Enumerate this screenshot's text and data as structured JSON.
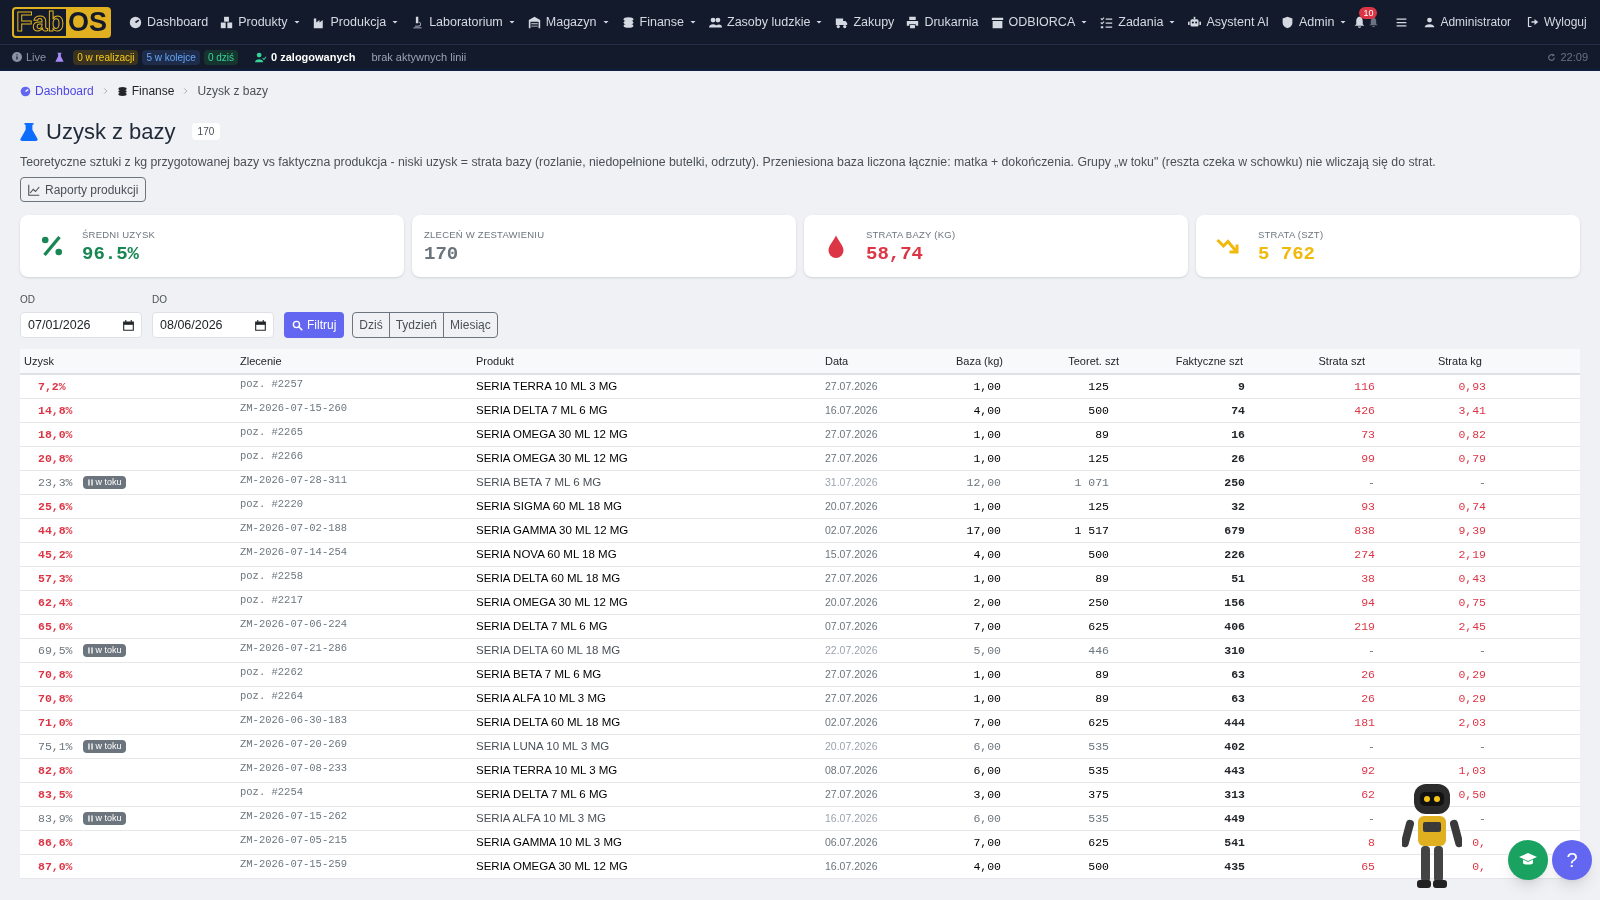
{
  "nav": {
    "logo": {
      "left": "Fab",
      "right": "OS"
    },
    "items": [
      {
        "label": "Dashboard",
        "dropdown": false
      },
      {
        "label": "Produkty",
        "dropdown": true
      },
      {
        "label": "Produkcja",
        "dropdown": true
      },
      {
        "label": "Laboratorium",
        "dropdown": true
      },
      {
        "label": "Magazyn",
        "dropdown": true
      },
      {
        "label": "Finanse",
        "dropdown": true
      },
      {
        "label": "Zasoby ludzkie",
        "dropdown": true
      },
      {
        "label": "Zakupy",
        "dropdown": false
      },
      {
        "label": "Drukarnia",
        "dropdown": false
      },
      {
        "label": "ODBIORCA",
        "dropdown": true
      },
      {
        "label": "Zadania",
        "dropdown": true
      },
      {
        "label": "Asystent AI",
        "dropdown": false
      },
      {
        "label": "Admin",
        "dropdown": true
      }
    ],
    "notifications": "10",
    "user": "Administrator",
    "logout": "Wyloguj"
  },
  "status_bar": {
    "live": "Live",
    "badges": [
      {
        "text": "0 w realizacji",
        "kind": "active"
      },
      {
        "text": "5 w kolejce",
        "kind": "queue"
      },
      {
        "text": "0 dziś",
        "kind": "today"
      }
    ],
    "logged_in": "0 zalogowanych",
    "lines": "brak aktywnych linii",
    "time": "22:09"
  },
  "breadcrumb": [
    {
      "label": "Dashboard",
      "kind": "link"
    },
    {
      "label": "Finanse",
      "kind": "section"
    },
    {
      "label": "Uzysk z bazy",
      "kind": "current"
    }
  ],
  "header": {
    "title": "Uzysk z bazy",
    "count": "170",
    "description": "Teoretyczne sztuki z kg przygotowanej bazy vs faktyczna produkcja - niski uzysk = strata bazy (rozlanie, niedopełnione butelki, odrzuty). Przeniesiona baza liczona łącznie: matka + dokończenia. Grupy „w toku\" (reszta czeka w schowku) nie wliczają się do strat.",
    "button": "Raporty produkcji"
  },
  "cards": [
    {
      "label": "ŚREDNI UZYSK",
      "value": "96.5%",
      "color": "#198754",
      "kind": "percent"
    },
    {
      "label": "ZLECEŃ W ZESTAWIENIU",
      "value": "170",
      "color": "#6c757d",
      "kind": "none"
    },
    {
      "label": "STRATA BAZY (KG)",
      "value": "58,74",
      "color": "#dc3545",
      "kind": "drop"
    },
    {
      "label": "STRATA (SZT)",
      "value": "5 762",
      "color": "#f0b90b",
      "kind": "trend"
    }
  ],
  "filters": {
    "from": {
      "label": "OD",
      "value": "07/01/2026"
    },
    "to": {
      "label": "DO",
      "value": "08/06/2026"
    },
    "submit": "Filtruj",
    "ranges": [
      "Dziś",
      "Tydzień",
      "Miesiąc"
    ]
  },
  "table": {
    "columns": [
      "Uzysk",
      "Zlecenie",
      "Produkt",
      "Data",
      "Baza (kg)",
      "Teoret. szt",
      "Faktyczne szt",
      "Strata szt",
      "Strata kg"
    ],
    "rows": [
      {
        "uzysk": "7,2%",
        "in_progress": false,
        "order": "poz. #2257",
        "product": "SERIA TERRA 10 ML 3 MG",
        "date": "27.07.2026",
        "base": "1,00",
        "theor": "125",
        "actual": "9",
        "loss_pcs": "116",
        "loss_kg": "0,93"
      },
      {
        "uzysk": "14,8%",
        "in_progress": false,
        "order": "ZM-2026-07-15-260",
        "product": "SERIA DELTA 7 ML 6 MG",
        "date": "16.07.2026",
        "base": "4,00",
        "theor": "500",
        "actual": "74",
        "loss_pcs": "426",
        "loss_kg": "3,41"
      },
      {
        "uzysk": "18,0%",
        "in_progress": false,
        "order": "poz. #2265",
        "product": "SERIA OMEGA 30 ML 12 MG",
        "date": "27.07.2026",
        "base": "1,00",
        "theor": "89",
        "actual": "16",
        "loss_pcs": "73",
        "loss_kg": "0,82"
      },
      {
        "uzysk": "20,8%",
        "in_progress": false,
        "order": "poz. #2266",
        "product": "SERIA OMEGA 30 ML 12 MG",
        "date": "27.07.2026",
        "base": "1,00",
        "theor": "125",
        "actual": "26",
        "loss_pcs": "99",
        "loss_kg": "0,79"
      },
      {
        "uzysk": "23,3%",
        "in_progress": true,
        "badge": "w toku",
        "order": "ZM-2026-07-28-311",
        "product": "SERIA BETA 7 ML 6 MG",
        "date": "31.07.2026",
        "base": "12,00",
        "theor": "1 071",
        "actual": "250",
        "loss_pcs": "-",
        "loss_kg": "-"
      },
      {
        "uzysk": "25,6%",
        "in_progress": false,
        "order": "poz. #2220",
        "product": "SERIA SIGMA 60 ML 18 MG",
        "date": "20.07.2026",
        "base": "1,00",
        "theor": "125",
        "actual": "32",
        "loss_pcs": "93",
        "loss_kg": "0,74"
      },
      {
        "uzysk": "44,8%",
        "in_progress": false,
        "order": "ZM-2026-07-02-188",
        "product": "SERIA GAMMA 30 ML 12 MG",
        "date": "02.07.2026",
        "base": "17,00",
        "theor": "1 517",
        "actual": "679",
        "loss_pcs": "838",
        "loss_kg": "9,39"
      },
      {
        "uzysk": "45,2%",
        "in_progress": false,
        "order": "ZM-2026-07-14-254",
        "product": "SERIA NOVA 60 ML 18 MG",
        "date": "15.07.2026",
        "base": "4,00",
        "theor": "500",
        "actual": "226",
        "loss_pcs": "274",
        "loss_kg": "2,19"
      },
      {
        "uzysk": "57,3%",
        "in_progress": false,
        "order": "poz. #2258",
        "product": "SERIA DELTA 60 ML 18 MG",
        "date": "27.07.2026",
        "base": "1,00",
        "theor": "89",
        "actual": "51",
        "loss_pcs": "38",
        "loss_kg": "0,43"
      },
      {
        "uzysk": "62,4%",
        "in_progress": false,
        "order": "poz. #2217",
        "product": "SERIA OMEGA 30 ML 12 MG",
        "date": "20.07.2026",
        "base": "2,00",
        "theor": "250",
        "actual": "156",
        "loss_pcs": "94",
        "loss_kg": "0,75"
      },
      {
        "uzysk": "65,0%",
        "in_progress": false,
        "order": "ZM-2026-07-06-224",
        "product": "SERIA DELTA 7 ML 6 MG",
        "date": "07.07.2026",
        "base": "7,00",
        "theor": "625",
        "actual": "406",
        "loss_pcs": "219",
        "loss_kg": "2,45"
      },
      {
        "uzysk": "69,5%",
        "in_progress": true,
        "badge": "w toku",
        "order": "ZM-2026-07-21-286",
        "product": "SERIA DELTA 60 ML 18 MG",
        "date": "22.07.2026",
        "base": "5,00",
        "theor": "446",
        "actual": "310",
        "loss_pcs": "-",
        "loss_kg": "-"
      },
      {
        "uzysk": "70,8%",
        "in_progress": false,
        "order": "poz. #2262",
        "product": "SERIA BETA 7 ML 6 MG",
        "date": "27.07.2026",
        "base": "1,00",
        "theor": "89",
        "actual": "63",
        "loss_pcs": "26",
        "loss_kg": "0,29"
      },
      {
        "uzysk": "70,8%",
        "in_progress": false,
        "order": "poz. #2264",
        "product": "SERIA ALFA 10 ML 3 MG",
        "date": "27.07.2026",
        "base": "1,00",
        "theor": "89",
        "actual": "63",
        "loss_pcs": "26",
        "loss_kg": "0,29"
      },
      {
        "uzysk": "71,0%",
        "in_progress": false,
        "order": "ZM-2026-06-30-183",
        "product": "SERIA DELTA 60 ML 18 MG",
        "date": "02.07.2026",
        "base": "7,00",
        "theor": "625",
        "actual": "444",
        "loss_pcs": "181",
        "loss_kg": "2,03"
      },
      {
        "uzysk": "75,1%",
        "in_progress": true,
        "badge": "w toku",
        "order": "ZM-2026-07-20-269",
        "product": "SERIA LUNA 10 ML 3 MG",
        "date": "20.07.2026",
        "base": "6,00",
        "theor": "535",
        "actual": "402",
        "loss_pcs": "-",
        "loss_kg": "-"
      },
      {
        "uzysk": "82,8%",
        "in_progress": false,
        "order": "ZM-2026-07-08-233",
        "product": "SERIA TERRA 10 ML 3 MG",
        "date": "08.07.2026",
        "base": "6,00",
        "theor": "535",
        "actual": "443",
        "loss_pcs": "92",
        "loss_kg": "1,03"
      },
      {
        "uzysk": "83,5%",
        "in_progress": false,
        "order": "poz. #2254",
        "product": "SERIA DELTA 7 ML 6 MG",
        "date": "27.07.2026",
        "base": "3,00",
        "theor": "375",
        "actual": "313",
        "loss_pcs": "62",
        "loss_kg": "0,50"
      },
      {
        "uzysk": "83,9%",
        "in_progress": true,
        "badge": "w toku",
        "order": "ZM-2026-07-15-262",
        "product": "SERIA ALFA 10 ML 3 MG",
        "date": "16.07.2026",
        "base": "6,00",
        "theor": "535",
        "actual": "449",
        "loss_pcs": "-",
        "loss_kg": "-"
      },
      {
        "uzysk": "86,6%",
        "in_progress": false,
        "order": "ZM-2026-07-05-215",
        "product": "SERIA GAMMA 10 ML 3 MG",
        "date": "06.07.2026",
        "base": "7,00",
        "theor": "625",
        "actual": "541",
        "loss_pcs": "8",
        "loss_kg": "0,"
      },
      {
        "uzysk": "87,0%",
        "in_progress": false,
        "order": "ZM-2026-07-15-259",
        "product": "SERIA OMEGA 30 ML 12 MG",
        "date": "16.07.2026",
        "base": "4,00",
        "theor": "500",
        "actual": "435",
        "loss_pcs": "65",
        "loss_kg": "0,"
      }
    ]
  },
  "help_button": "?"
}
